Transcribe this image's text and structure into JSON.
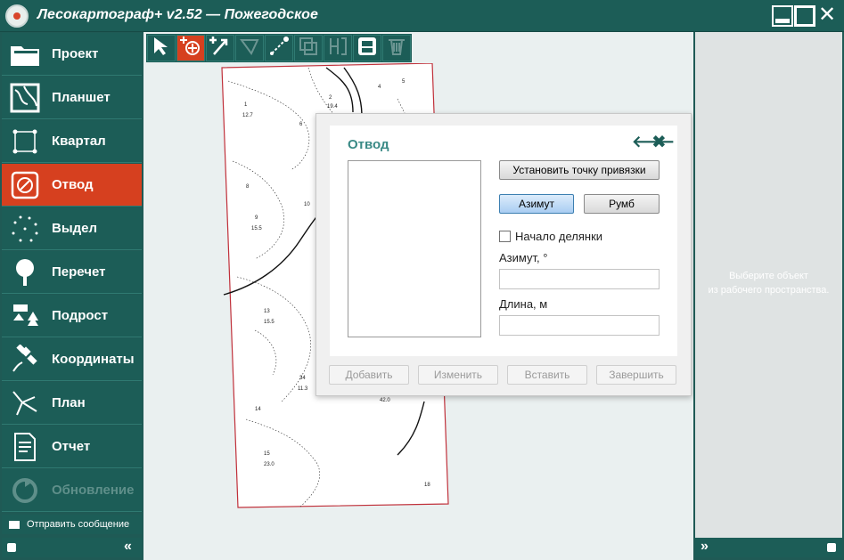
{
  "window": {
    "title": "Лесокартограф+ v2.52 — Пожегодское"
  },
  "nav": [
    {
      "label": "Проект",
      "icon": "folder-icon",
      "active": false,
      "disabled": false
    },
    {
      "label": "Планшет",
      "icon": "map-sheet-icon",
      "active": false,
      "disabled": false
    },
    {
      "label": "Квартал",
      "icon": "quarter-icon",
      "active": false,
      "disabled": false
    },
    {
      "label": "Отвод",
      "icon": "compass-icon",
      "active": true,
      "disabled": false
    },
    {
      "label": "Выдел",
      "icon": "dotted-area-icon",
      "active": false,
      "disabled": false
    },
    {
      "label": "Перечет",
      "icon": "tree-icon",
      "active": false,
      "disabled": false
    },
    {
      "label": "Подрост",
      "icon": "saplings-icon",
      "active": false,
      "disabled": false
    },
    {
      "label": "Координаты",
      "icon": "satellite-icon",
      "active": false,
      "disabled": false
    },
    {
      "label": "План",
      "icon": "plan-icon",
      "active": false,
      "disabled": false
    },
    {
      "label": "Отчет",
      "icon": "report-icon",
      "active": false,
      "disabled": false
    },
    {
      "label": "Обновление",
      "icon": "update-icon",
      "active": false,
      "disabled": true
    }
  ],
  "send_message": "Отправить сообщение",
  "toolbar": [
    {
      "name": "select-arrow-icon",
      "active": false,
      "disabled": false
    },
    {
      "name": "add-point-icon",
      "active": true,
      "disabled": false
    },
    {
      "name": "add-line-icon",
      "active": false,
      "disabled": false
    },
    {
      "name": "shape-icon",
      "active": false,
      "disabled": true
    },
    {
      "name": "edit-node-icon",
      "active": false,
      "disabled": false
    },
    {
      "name": "copy-icon",
      "active": false,
      "disabled": true
    },
    {
      "name": "split-icon",
      "active": false,
      "disabled": true
    },
    {
      "name": "print-icon",
      "active": false,
      "disabled": false
    },
    {
      "name": "trash-icon",
      "active": false,
      "disabled": true
    }
  ],
  "map": {
    "labels": [
      "1",
      "12.7",
      "2",
      "19.4",
      "4",
      "5",
      "6",
      "8",
      "9",
      "15.5",
      "10",
      "13",
      "15.5",
      "14",
      "34",
      "11.3",
      "42.0",
      "15",
      "23.0",
      "18"
    ]
  },
  "dialog": {
    "title": "Отвод",
    "set_point_button": "Установить точку привязки",
    "azimuth_button": "Азимут",
    "rumb_button": "Румб",
    "start_checkbox": "Начало делянки",
    "azimuth_label": "Азимут, °",
    "azimuth_value": "",
    "length_label": "Длина, м",
    "length_value": "",
    "add_button": "Добавить",
    "change_button": "Изменить",
    "insert_button": "Вставить",
    "finish_button": "Завершить"
  },
  "right_panel": {
    "hint_line1": "Выберите объект",
    "hint_line2": "из рабочего пространства."
  },
  "colors": {
    "accent": "#d6401f",
    "teal": "#1c5d57",
    "dialog_title": "#3a8a86"
  }
}
